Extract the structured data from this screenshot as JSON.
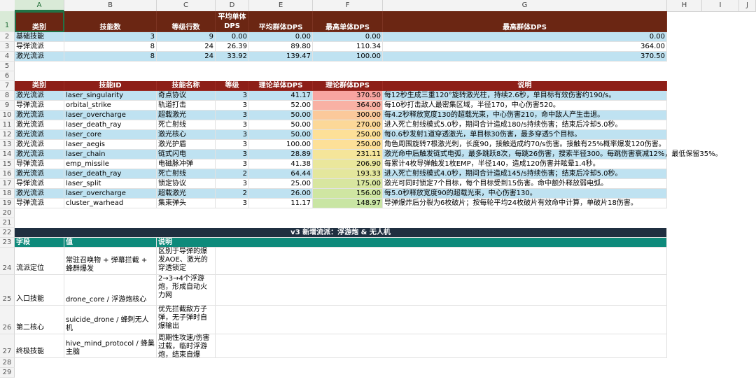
{
  "columns": [
    "A",
    "B",
    "C",
    "D",
    "E",
    "F",
    "G",
    "H",
    "I",
    "J"
  ],
  "rows": [
    "1",
    "2",
    "3",
    "4",
    "5",
    "6",
    "7",
    "8",
    "9",
    "10",
    "11",
    "12",
    "13",
    "14",
    "15",
    "16",
    "17",
    "18",
    "19",
    "20",
    "21",
    "22",
    "23",
    "24",
    "25",
    "26",
    "27",
    "28",
    "29"
  ],
  "summary": {
    "headers": [
      "类别",
      "技能数",
      "等级行数",
      "平均单体DPS",
      "平均群体DPS",
      "最高单体DPS",
      "最高群体DPS"
    ],
    "rows": [
      [
        "基础技能",
        "3",
        "9",
        "0.00",
        "0.00",
        "0.00",
        "0.00"
      ],
      [
        "导弹流派",
        "8",
        "24",
        "26.39",
        "89.80",
        "110.34",
        "364.00"
      ],
      [
        "激光流派",
        "8",
        "24",
        "33.92",
        "139.47",
        "100.00",
        "370.50"
      ]
    ]
  },
  "detail": {
    "headers": [
      "类别",
      "技能ID",
      "技能名称",
      "等级",
      "理论单体DPS",
      "理论群体DPS",
      "说明"
    ],
    "rows": [
      [
        "激光流派",
        "laser_singularity",
        "奇点协议",
        "3",
        "41.17",
        "370.50",
        "每12秒生成三重120°旋转激光柱，持续2.6秒，单目标有效伤害约190/s。"
      ],
      [
        "导弹流派",
        "orbital_strike",
        "轨道打击",
        "3",
        "52.00",
        "364.00",
        "每10秒打击敌人最密集区域，半径170，中心伤害520。"
      ],
      [
        "激光流派",
        "laser_overcharge",
        "超载激光",
        "3",
        "50.00",
        "300.00",
        "每4.2秒释放宽度130的超载光束，中心伤害210，命中敌人产生击退。"
      ],
      [
        "激光流派",
        "laser_death_ray",
        "死亡射线",
        "3",
        "50.00",
        "270.00",
        "进入死亡射线模式5.0秒，期间合计造成180/s持续伤害；结束后冷却5.0秒。"
      ],
      [
        "激光流派",
        "laser_core",
        "激光核心",
        "3",
        "50.00",
        "250.00",
        "每0.6秒发射1道穿透激光，单目标30伤害，最多穿透5个目标。"
      ],
      [
        "激光流派",
        "laser_aegis",
        "激光护盾",
        "3",
        "100.00",
        "250.00",
        "角色周围旋转7根激光刺，长度90，接触造成约70/s伤害。接触有25%概率爆发120伤害。"
      ],
      [
        "激光流派",
        "laser_chain",
        "链式闪电",
        "3",
        "28.89",
        "231.11",
        "激光命中后触发链式电弧，最多跳跃8次，每跳26伤害，搜索半径300。每跳伤害衰减12%，最低保留35%。"
      ],
      [
        "导弹流派",
        "emp_missile",
        "电磁脉冲弹",
        "3",
        "41.38",
        "206.90",
        "每累计4枚导弹触发1枚EMP，半径140，造成120伤害并眩晕1.4秒。"
      ],
      [
        "激光流派",
        "laser_death_ray",
        "死亡射线",
        "2",
        "64.44",
        "193.33",
        "进入死亡射线模式4.0秒，期间合计造成145/s持续伤害；结束后冷却5.0秒。"
      ],
      [
        "导弹流派",
        "laser_split",
        "锁定协议",
        "3",
        "25.00",
        "175.00",
        "激光可同时锁定7个目标，每个目标受到15伤害。命中额外释放弱电弧。"
      ],
      [
        "激光流派",
        "laser_overcharge",
        "超载激光",
        "2",
        "26.00",
        "156.00",
        "每5.0秒释放宽度90的超载光束，中心伤害130。"
      ],
      [
        "导弹流派",
        "cluster_warhead",
        "集束弹头",
        "3",
        "11.17",
        "148.97",
        "导弹爆炸后分裂为6枚破片；按每轮平均24枚破片有效命中计算，单破片18伤害。"
      ]
    ]
  },
  "v3": {
    "title": "v3 新增流派：浮游炮 & 无人机",
    "headers": [
      "字段",
      "值",
      "说明"
    ],
    "rows": [
      [
        "流派定位",
        "常驻召唤物 + 弹幕拦截 + 蜂群爆发",
        "区别于导弹的爆发AOE、激光的穿透锁定"
      ],
      [
        "入口技能",
        "drone_core / 浮游炮核心",
        "2→3→4个浮游炮，形成自动火力网"
      ],
      [
        "第二核心",
        "suicide_drone / 蜂刺无人机",
        "优先拦截敌方子弹，无子弹时自爆输出"
      ],
      [
        "终极技能",
        "hive_mind_protocol / 蜂巢主脑",
        "周期性攻速/伤害过载，临时浮游炮，结束自爆"
      ]
    ]
  },
  "colors": {
    "summary_header": "#6b2613",
    "detail_header": "#8d1f18",
    "row_blue": "#bfe2f1",
    "v3_title": "#1f2f40",
    "v3_header": "#0e8a7b",
    "heat": [
      "#f8a5a1",
      "#f9b1a4",
      "#fbc99b",
      "#fcd898",
      "#fde098",
      "#fde098",
      "#f5e59a",
      "#eae79c",
      "#e4e79d",
      "#d8e6a0",
      "#cfe6a2",
      "#c9e5a4"
    ]
  }
}
